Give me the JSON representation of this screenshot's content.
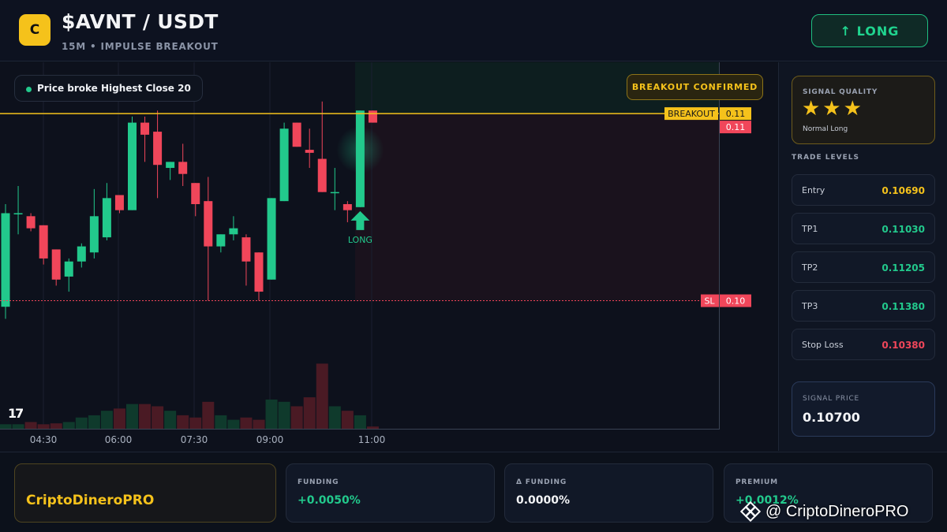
{
  "header": {
    "logo_letter": "C",
    "pair": "$AVNT / USDT",
    "subtitle": "15M • IMPULSE BREAKOUT",
    "direction_button": "↑ LONG"
  },
  "chart": {
    "status_text": "Price broke Highest Close 20",
    "confirm_badge": "BREAKOUT CONFIRMED",
    "breakout_label": "BREAKOUT",
    "breakout_value": "0.11",
    "last_price_value": "0.11",
    "sl_label": "SL",
    "sl_value": "0.10",
    "signal_marker_text": "LONG",
    "time_labels": [
      "04:30",
      "06:00",
      "07:30",
      "09:00",
      "11:00"
    ],
    "tv_logo": "17",
    "colors": {
      "up": "#22c98c",
      "down": "#f0465a",
      "breakout": "#f5c21b"
    }
  },
  "chart_data": {
    "type": "candlestick",
    "xlabel": "",
    "ylabel": "",
    "x": [
      "04:30",
      "06:00",
      "07:30",
      "09:00",
      "11:00"
    ],
    "ylim": [
      0.1023,
      0.1117
    ],
    "breakout_level": 0.11,
    "stop_loss_level": 0.1038,
    "candles": [
      {
        "o": 0.1036,
        "h": 0.107,
        "l": 0.1032,
        "c": 0.1067
      },
      {
        "o": 0.1067,
        "h": 0.1076,
        "l": 0.106,
        "c": 0.1067
      },
      {
        "o": 0.1066,
        "h": 0.1067,
        "l": 0.1061,
        "c": 0.1062
      },
      {
        "o": 0.1063,
        "h": 0.1063,
        "l": 0.105,
        "c": 0.1052
      },
      {
        "o": 0.1055,
        "h": 0.1055,
        "l": 0.1043,
        "c": 0.1045
      },
      {
        "o": 0.1046,
        "h": 0.1052,
        "l": 0.1041,
        "c": 0.1051
      },
      {
        "o": 0.1051,
        "h": 0.1057,
        "l": 0.1049,
        "c": 0.1056
      },
      {
        "o": 0.1054,
        "h": 0.1075,
        "l": 0.1052,
        "c": 0.1066
      },
      {
        "o": 0.1059,
        "h": 0.1077,
        "l": 0.1058,
        "c": 0.1072
      },
      {
        "o": 0.1073,
        "h": 0.1073,
        "l": 0.1067,
        "c": 0.1068
      },
      {
        "o": 0.1068,
        "h": 0.1099,
        "l": 0.1068,
        "c": 0.1097
      },
      {
        "o": 0.1097,
        "h": 0.1099,
        "l": 0.1084,
        "c": 0.1093
      },
      {
        "o": 0.1094,
        "h": 0.1101,
        "l": 0.1072,
        "c": 0.1083
      },
      {
        "o": 0.1082,
        "h": 0.1084,
        "l": 0.1078,
        "c": 0.1084
      },
      {
        "o": 0.1084,
        "h": 0.109,
        "l": 0.1076,
        "c": 0.108
      },
      {
        "o": 0.1077,
        "h": 0.1077,
        "l": 0.1066,
        "c": 0.107
      },
      {
        "o": 0.1071,
        "h": 0.1079,
        "l": 0.1038,
        "c": 0.1056
      },
      {
        "o": 0.1056,
        "h": 0.106,
        "l": 0.1054,
        "c": 0.106
      },
      {
        "o": 0.106,
        "h": 0.1066,
        "l": 0.1058,
        "c": 0.1062
      },
      {
        "o": 0.1059,
        "h": 0.106,
        "l": 0.1043,
        "c": 0.1051
      },
      {
        "o": 0.1054,
        "h": 0.1054,
        "l": 0.1038,
        "c": 0.1041
      },
      {
        "o": 0.1045,
        "h": 0.1072,
        "l": 0.1045,
        "c": 0.1072
      },
      {
        "o": 0.1071,
        "h": 0.1097,
        "l": 0.1071,
        "c": 0.1095
      },
      {
        "o": 0.1097,
        "h": 0.1097,
        "l": 0.1089,
        "c": 0.1089
      },
      {
        "o": 0.1088,
        "h": 0.1095,
        "l": 0.1082,
        "c": 0.1087
      },
      {
        "o": 0.1085,
        "h": 0.1104,
        "l": 0.1074,
        "c": 0.1074
      },
      {
        "o": 0.1074,
        "h": 0.1082,
        "l": 0.1068,
        "c": 0.1074
      },
      {
        "o": 0.107,
        "h": 0.1071,
        "l": 0.1064,
        "c": 0.1068
      },
      {
        "o": 0.1069,
        "h": 0.1101,
        "l": 0.1069,
        "c": 0.1101
      },
      {
        "o": 0.1101,
        "h": 0.1101,
        "l": 0.1097,
        "c": 0.1097
      }
    ],
    "volumes": [
      1,
      1,
      1.5,
      1,
      1.2,
      1.5,
      2.5,
      3,
      4,
      4.5,
      5.5,
      5.5,
      5,
      4,
      3,
      2.5,
      6,
      3,
      2,
      2.5,
      2,
      6.5,
      6,
      5,
      7,
      14.5,
      5,
      4,
      3,
      0.5
    ]
  },
  "sidebar": {
    "quality_label": "SIGNAL QUALITY",
    "stars": "★★★",
    "quality_desc": "Normal Long",
    "levels_title": "TRADE LEVELS",
    "levels": [
      {
        "name": "Entry",
        "value": "0.10690",
        "color": "#f5c21b"
      },
      {
        "name": "TP1",
        "value": "0.11030",
        "color": "#22c98c"
      },
      {
        "name": "TP2",
        "value": "0.11205",
        "color": "#22c98c"
      },
      {
        "name": "TP3",
        "value": "0.11380",
        "color": "#22c98c"
      },
      {
        "name": "Stop Loss",
        "value": "0.10380",
        "color": "#f0465a"
      }
    ],
    "signal_price_label": "SIGNAL PRICE",
    "signal_price": "0.10700"
  },
  "footer": {
    "brand": "CriptoDineroPRO",
    "metrics": [
      {
        "label": "FUNDING",
        "value": "+0.0050%",
        "color": "#22c98c"
      },
      {
        "label": "Δ FUNDING",
        "value": "0.0000%",
        "color": "#f3f4f6"
      },
      {
        "label": "PREMIUM",
        "value": "+0.0012%",
        "color": "#22c98c"
      }
    ],
    "watermark": "@ CriptoDineroPRO"
  }
}
